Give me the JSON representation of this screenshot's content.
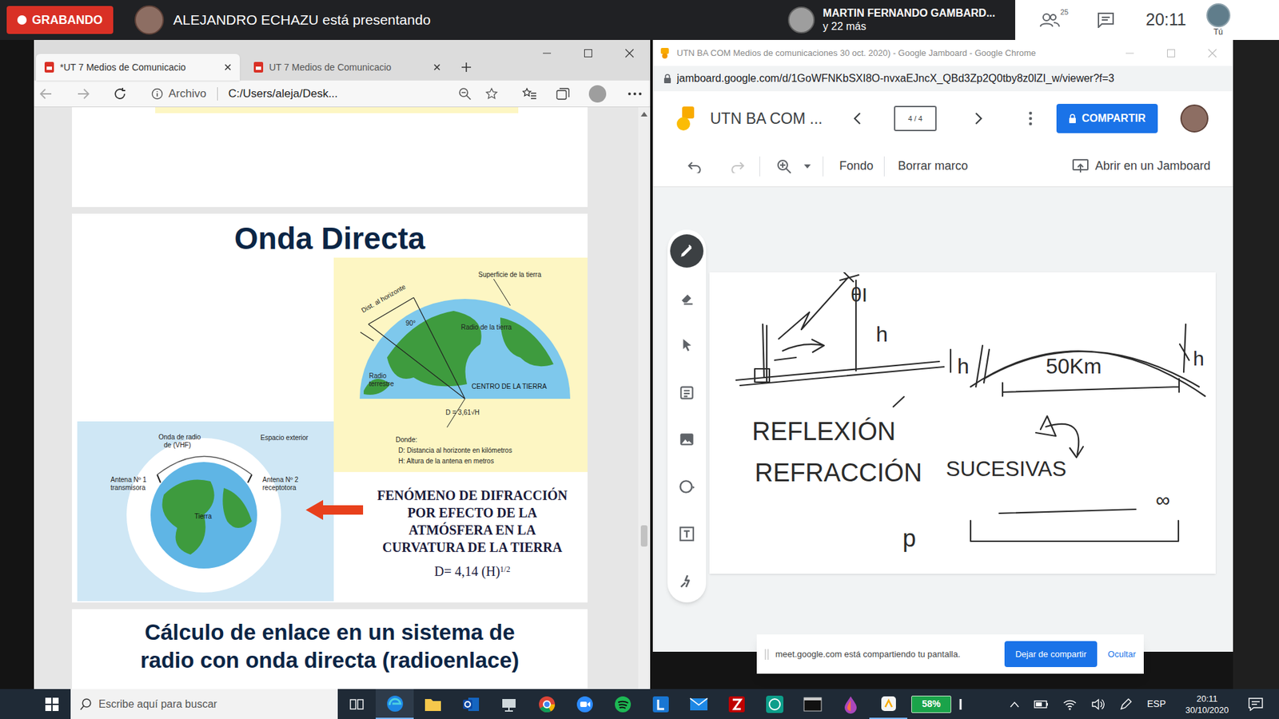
{
  "meet": {
    "recording_badge": "GRABANDO",
    "presenter": "ALEJANDRO ECHAZU está presentando",
    "participant_name": "MARTIN FERNANDO GAMBARD...",
    "participant_more": "y 22 más",
    "participants_count": "25",
    "time": "20:11",
    "self_label": "Tú"
  },
  "edge": {
    "tabs": [
      {
        "label": "*UT 7 Medios de Comunicacio",
        "selected": true
      },
      {
        "label": "UT 7 Medios de Comunicacio",
        "selected": false
      }
    ],
    "address_prefix": "Archivo",
    "address": "C:/Users/aleja/Desk..."
  },
  "pdf": {
    "heading": "Onda Directa",
    "figure_horizon_labels": [
      "Superficie de la tierra",
      "Dist. al horizonte",
      "90°",
      "Radio de la tierra",
      "Radio",
      "terrestre",
      "CENTRO DE LA TIERRA",
      "D = 3,61√H",
      "Donde:",
      "D: Distancia al horizonte en kilómetros",
      "H: Altura de la antena en metros"
    ],
    "figure_vhf_labels": [
      "Onda de radio",
      "de (VHF)",
      "Espacio exterior",
      "Antena Nº 1",
      "transmisora",
      "Antena Nº 2",
      "receptotora",
      "Tierra"
    ],
    "caption": [
      "FENÓMENO DE DIFRACCIÓN",
      "POR EFECTO DE LA",
      "ATMÓSFERA EN LA",
      "CURVATURA DE LA TIERRA"
    ],
    "formula_base": "D= 4,14 (H)",
    "formula_exponent": "1/2",
    "next_heading": [
      "Cálculo de enlace en un sistema de",
      "radio con onda directa (radioenlace)"
    ]
  },
  "chrome": {
    "title": "UTN BA COM Medios de comunicaciones 30 oct. 2020) - Google Jamboard - Google Chrome",
    "url": "jamboard.google.com/d/1GoWFNKbSXI8O-nvxaEJncX_QBd3Zp2Q0tby8z0lZI_w/viewer?f=3"
  },
  "jamboard": {
    "title": "UTN BA COM ...",
    "frame_counter": "4 / 4",
    "share": "COMPARTIR",
    "toolbar": [
      "Fondo",
      "Borrar marco"
    ],
    "open_in_jamboard": "Abrir en un Jamboard",
    "tools": [
      {
        "kind": "pen",
        "selected": true
      },
      {
        "kind": "eraser",
        "selected": false
      },
      {
        "kind": "select",
        "selected": false
      },
      {
        "kind": "sticky",
        "selected": false
      },
      {
        "kind": "image",
        "selected": false
      },
      {
        "kind": "circle",
        "selected": false
      },
      {
        "kind": "textbox",
        "selected": false
      },
      {
        "kind": "laser",
        "selected": false
      }
    ],
    "sketch_labels": [
      "θI",
      "h",
      "h",
      "50Km",
      "h",
      "REFLEXIÓN",
      "REFRACCIÓN",
      "SUCESIVAS",
      "p",
      "∞"
    ]
  },
  "share_banner": {
    "message": "meet.google.com está compartiendo tu pantalla.",
    "stop": "Dejar de compartir",
    "hide": "Ocultar"
  },
  "taskbar": {
    "search_placeholder": "Escribe aquí para buscar",
    "battery": "58%",
    "language": "ESP",
    "time": "20:11",
    "date": "30/10/2020"
  }
}
